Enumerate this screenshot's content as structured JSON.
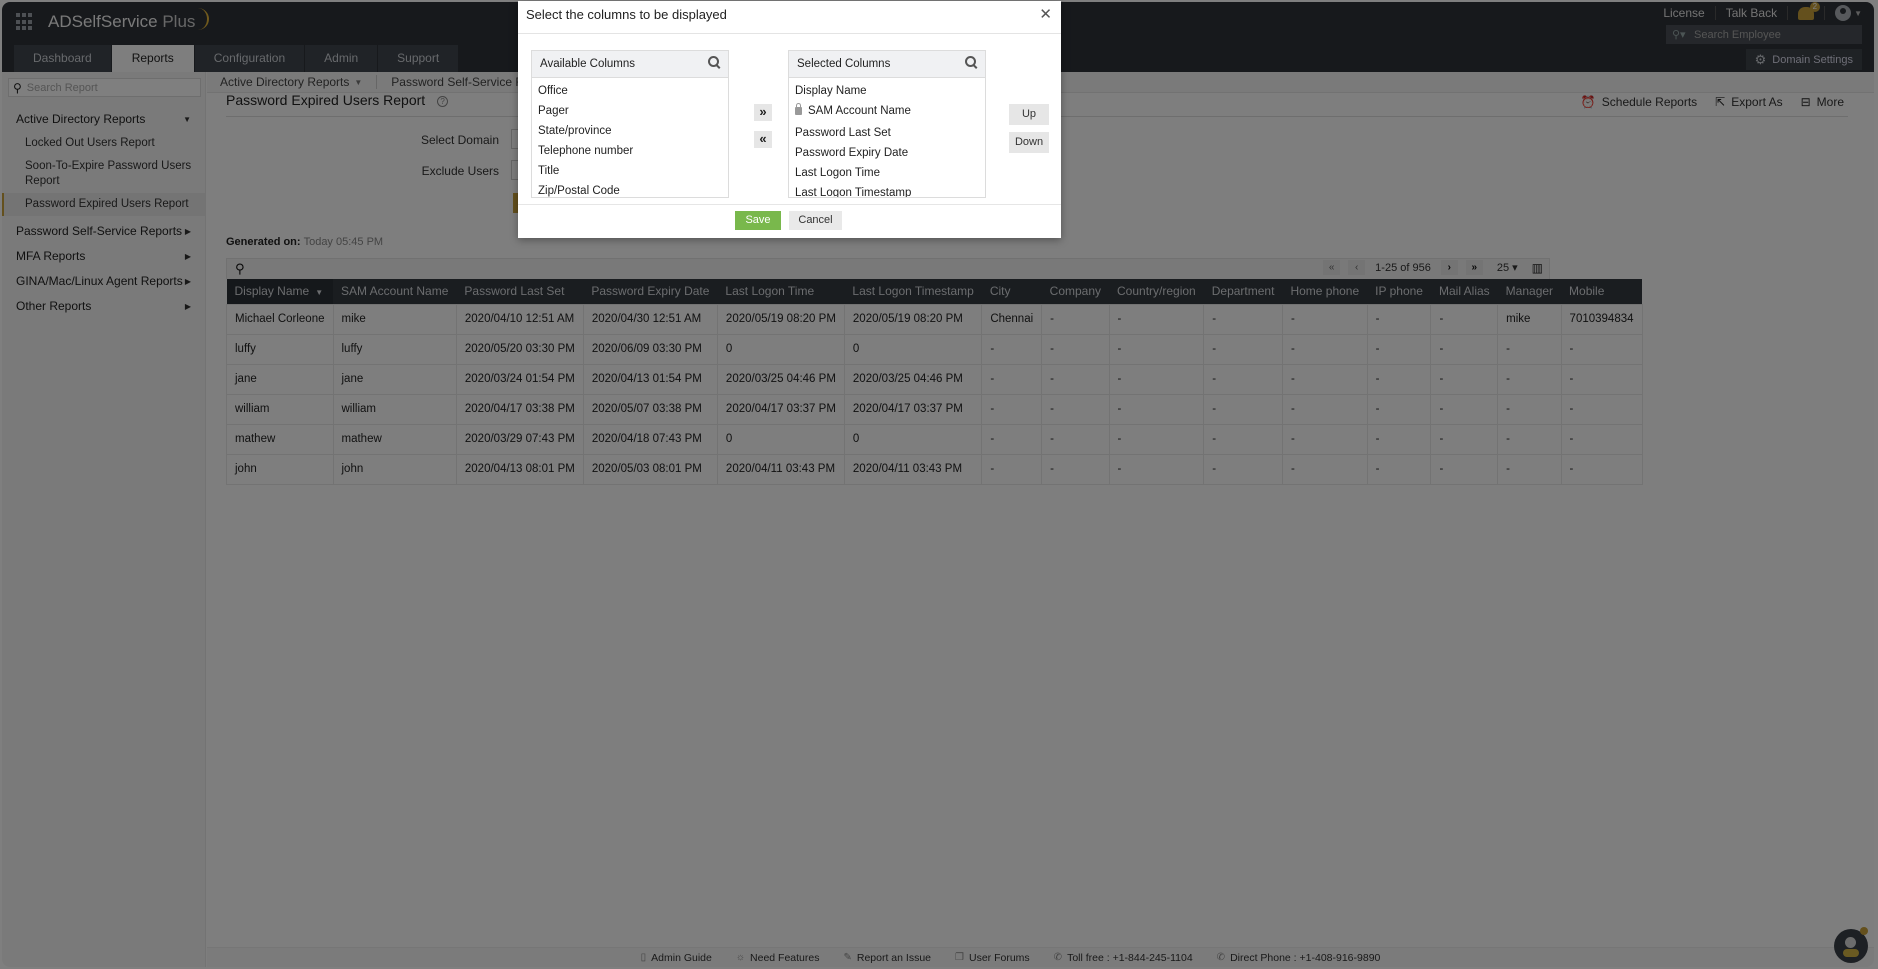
{
  "app": {
    "name": "ADSelfService",
    "name_suffix": "Plus"
  },
  "header": {
    "tabs": [
      "Dashboard",
      "Reports",
      "Configuration",
      "Admin",
      "Support"
    ],
    "active_tab": "Reports",
    "links": {
      "license": "License",
      "talk_back": "Talk Back"
    },
    "notification_count": "2",
    "search_employee_placeholder": "Search Employee",
    "domain_settings": "Domain Settings"
  },
  "sidebar": {
    "search_placeholder": "Search Report",
    "groups": [
      {
        "label": "Active Directory Reports",
        "expanded": true,
        "items": [
          {
            "label": "Locked Out Users Report"
          },
          {
            "label": "Soon-To-Expire Password Users Report"
          },
          {
            "label": "Password Expired Users Report",
            "active": true
          }
        ]
      },
      {
        "label": "Password Self-Service Reports",
        "expanded": false
      },
      {
        "label": "MFA Reports",
        "expanded": false
      },
      {
        "label": "GINA/Mac/Linux Agent Reports",
        "expanded": false
      },
      {
        "label": "Other Reports",
        "expanded": false
      }
    ]
  },
  "subnav": {
    "items": [
      "Active Directory Reports",
      "Password Self-Service Reports"
    ]
  },
  "report": {
    "title": "Password Expired Users Report",
    "actions": {
      "schedule": "Schedule Reports",
      "export": "Export As",
      "more": "More"
    },
    "form": {
      "select_domain_label": "Select Domain",
      "exclude_users_label": "Exclude Users"
    },
    "generated_label": "Generated on:",
    "generated_value": "Today 05:45 PM",
    "pager": {
      "range": "1-25 of 956",
      "page_size": "25"
    },
    "columns": [
      "Display Name",
      "SAM Account Name",
      "Password Last Set",
      "Password Expiry Date",
      "Last Logon Time",
      "Last Logon Timestamp",
      "City",
      "Company",
      "Country/region",
      "Department",
      "Home phone",
      "IP phone",
      "Mail Alias",
      "Manager",
      "Mobile"
    ],
    "sorted_column": "Display Name",
    "rows": [
      [
        "Michael Corleone",
        "mike",
        "2020/04/10 12:51 AM",
        "2020/04/30 12:51 AM",
        "2020/05/19 08:20 PM",
        "2020/05/19 08:20 PM",
        "Chennai",
        "-",
        "-",
        "-",
        "-",
        "-",
        "-",
        "mike",
        "7010394834"
      ],
      [
        "luffy",
        "luffy",
        "2020/05/20 03:30 PM",
        "2020/06/09 03:30 PM",
        "0",
        "0",
        "-",
        "-",
        "-",
        "-",
        "-",
        "-",
        "-",
        "-",
        "-"
      ],
      [
        "jane",
        "jane",
        "2020/03/24 01:54 PM",
        "2020/04/13 01:54 PM",
        "2020/03/25 04:46 PM",
        "2020/03/25 04:46 PM",
        "-",
        "-",
        "-",
        "-",
        "-",
        "-",
        "-",
        "-",
        "-"
      ],
      [
        "william",
        "william",
        "2020/04/17 03:38 PM",
        "2020/05/07 03:38 PM",
        "2020/04/17 03:37 PM",
        "2020/04/17 03:37 PM",
        "-",
        "-",
        "-",
        "-",
        "-",
        "-",
        "-",
        "-",
        "-"
      ],
      [
        "mathew",
        "mathew",
        "2020/03/29 07:43 PM",
        "2020/04/18 07:43 PM",
        "0",
        "0",
        "-",
        "-",
        "-",
        "-",
        "-",
        "-",
        "-",
        "-",
        "-"
      ],
      [
        "john",
        "john",
        "2020/04/13 08:01 PM",
        "2020/05/03 08:01 PM",
        "2020/04/11 03:43 PM",
        "2020/04/11 03:43 PM",
        "-",
        "-",
        "-",
        "-",
        "-",
        "-",
        "-",
        "-",
        "-"
      ]
    ]
  },
  "footer": {
    "items": [
      "Admin Guide",
      "Need Features",
      "Report an Issue",
      "User Forums",
      "Toll free : +1-844-245-1104",
      "Direct Phone : +1-408-916-9890"
    ]
  },
  "modal": {
    "title": "Select the columns to be displayed",
    "available_title": "Available Columns",
    "available": [
      "Office",
      "Pager",
      "State/province",
      "Telephone number",
      "Title",
      "Zip/Postal Code"
    ],
    "selected_title": "Selected Columns",
    "selected": [
      {
        "label": "Display Name",
        "locked": false
      },
      {
        "label": "SAM Account Name",
        "locked": true
      },
      {
        "label": "Password Last Set",
        "locked": false
      },
      {
        "label": "Password Expiry Date",
        "locked": false
      },
      {
        "label": "Last Logon Time",
        "locked": false
      },
      {
        "label": "Last Logon Timestamp",
        "locked": false
      }
    ],
    "move_right": "»",
    "move_left": "«",
    "up": "Up",
    "down": "Down",
    "save": "Save",
    "cancel": "Cancel"
  },
  "colors": {
    "header_bg": "#2e3238",
    "accent_gold": "#c9a13a",
    "save_green": "#79b84c",
    "table_header_bg": "#343a41"
  }
}
